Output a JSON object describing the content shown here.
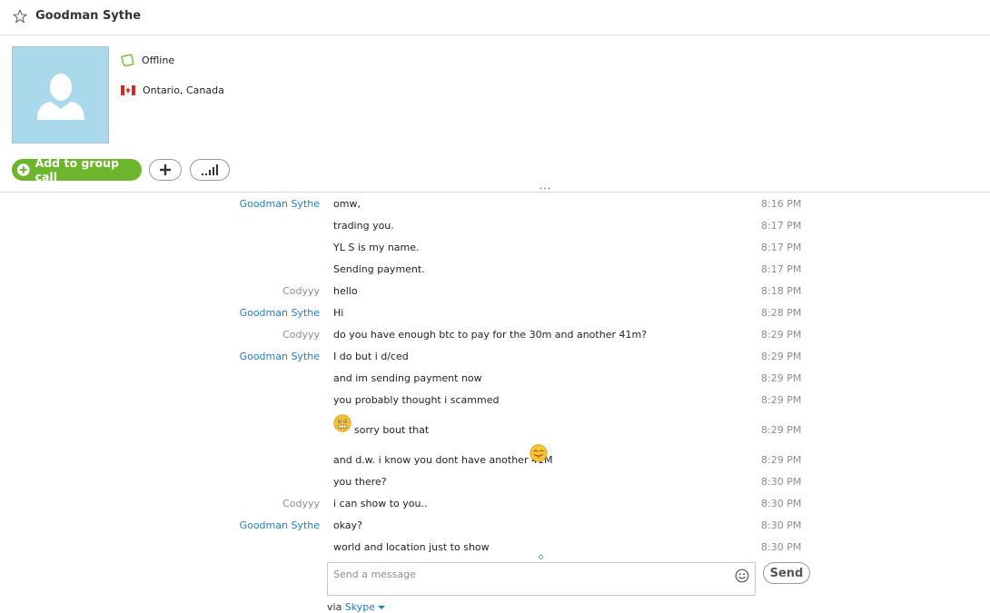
{
  "header": {
    "contact_name": "Goodman Sythe"
  },
  "profile": {
    "status": "Offline",
    "location": "Ontario, Canada"
  },
  "actions": {
    "add_to_group_call": "Add to group call"
  },
  "messages": [
    {
      "sender": "Goodman Sythe",
      "side": "them",
      "text": "omw,",
      "time": "8:16 PM"
    },
    {
      "sender": "",
      "side": "them",
      "text": "trading you.",
      "time": "8:17 PM"
    },
    {
      "sender": "",
      "side": "them",
      "text": "YL S is my name.",
      "time": "8:17 PM"
    },
    {
      "sender": "",
      "side": "them",
      "text": "Sending payment.",
      "time": "8:17 PM"
    },
    {
      "sender": "Codyyy",
      "side": "me",
      "text": "hello",
      "time": "8:18 PM"
    },
    {
      "sender": "Goodman Sythe",
      "side": "them",
      "text": "Hi",
      "time": "8:28 PM"
    },
    {
      "sender": "Codyyy",
      "side": "me",
      "text": "do you have enough btc to pay for the 30m and another 41m?",
      "time": "8:29 PM"
    },
    {
      "sender": "Goodman Sythe",
      "side": "them",
      "text": "I do but i d/ced",
      "time": "8:29 PM"
    },
    {
      "sender": "",
      "side": "them",
      "text": "and im sending payment now",
      "time": "8:29 PM"
    },
    {
      "sender": "",
      "side": "them",
      "text": "you probably thought i scammed",
      "time": "8:29 PM"
    },
    {
      "sender": "",
      "side": "them",
      "text": "sorry bout that",
      "time": "8:29 PM",
      "emoji_before": "nervous-emoji"
    },
    {
      "sender": "",
      "side": "them",
      "text": "and d.w. i know you dont have another 41M",
      "time": "8:29 PM",
      "emoji_after": "tongue-emoji"
    },
    {
      "sender": "",
      "side": "them",
      "text": "you there?",
      "time": "8:30 PM"
    },
    {
      "sender": "Codyyy",
      "side": "me",
      "text": "i can show to you..",
      "time": "8:30 PM"
    },
    {
      "sender": "Goodman Sythe",
      "side": "them",
      "text": "okay?",
      "time": "8:30 PM"
    },
    {
      "sender": "",
      "side": "them",
      "text": "world and location just to show",
      "time": "8:30 PM"
    }
  ],
  "compose": {
    "placeholder": "Send a message",
    "value": ""
  },
  "send_label": "Send",
  "footer": {
    "via": "via",
    "service": "Skype"
  },
  "colors": {
    "accent_green": "#6cb52d",
    "link_blue": "#1e7fc5",
    "muted_gray": "#8d8d8d",
    "avatar_bg": "#a9d9ea"
  },
  "icons": [
    "star-icon",
    "offline-status-icon",
    "canada-flag-icon",
    "plus-icon",
    "call-quality-icon",
    "smiley-icon",
    "nervous-emoji",
    "tongue-emoji"
  ]
}
